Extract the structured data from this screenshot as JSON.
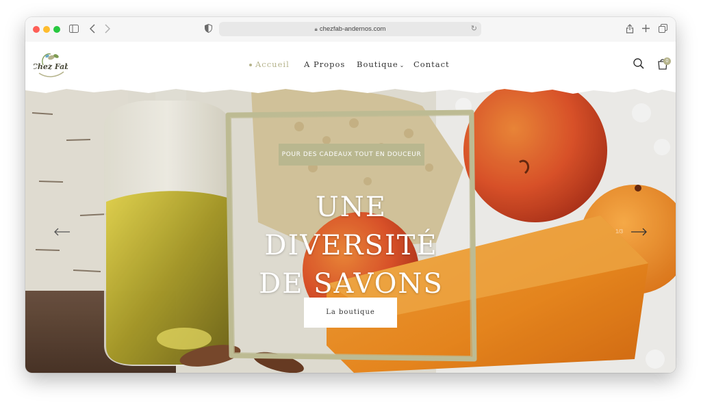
{
  "browser": {
    "url": "chezfab-andernos.com",
    "icons": [
      "sidebar-icon",
      "back-icon",
      "forward-icon",
      "shield-icon",
      "lock-icon",
      "reload-icon",
      "share-icon",
      "new-tab-icon",
      "tabs-overview-icon"
    ]
  },
  "site": {
    "logo_text": "Chez Fab",
    "nav": [
      {
        "label": "Accueil",
        "active": true
      },
      {
        "label": "A Propos"
      },
      {
        "label": "Boutique",
        "has_dropdown": true
      },
      {
        "label": "Contact"
      }
    ],
    "cart_count": "0",
    "accent_color": "#b5b38b"
  },
  "hero": {
    "tagline": "POUR DES CADEAUX TOUT EN DOUCEUR",
    "title_line1": "UNE DIVERSITÉ",
    "title_line2": "DE SAVONS",
    "button_label": "La boutique",
    "slide_counter": "1/3"
  }
}
